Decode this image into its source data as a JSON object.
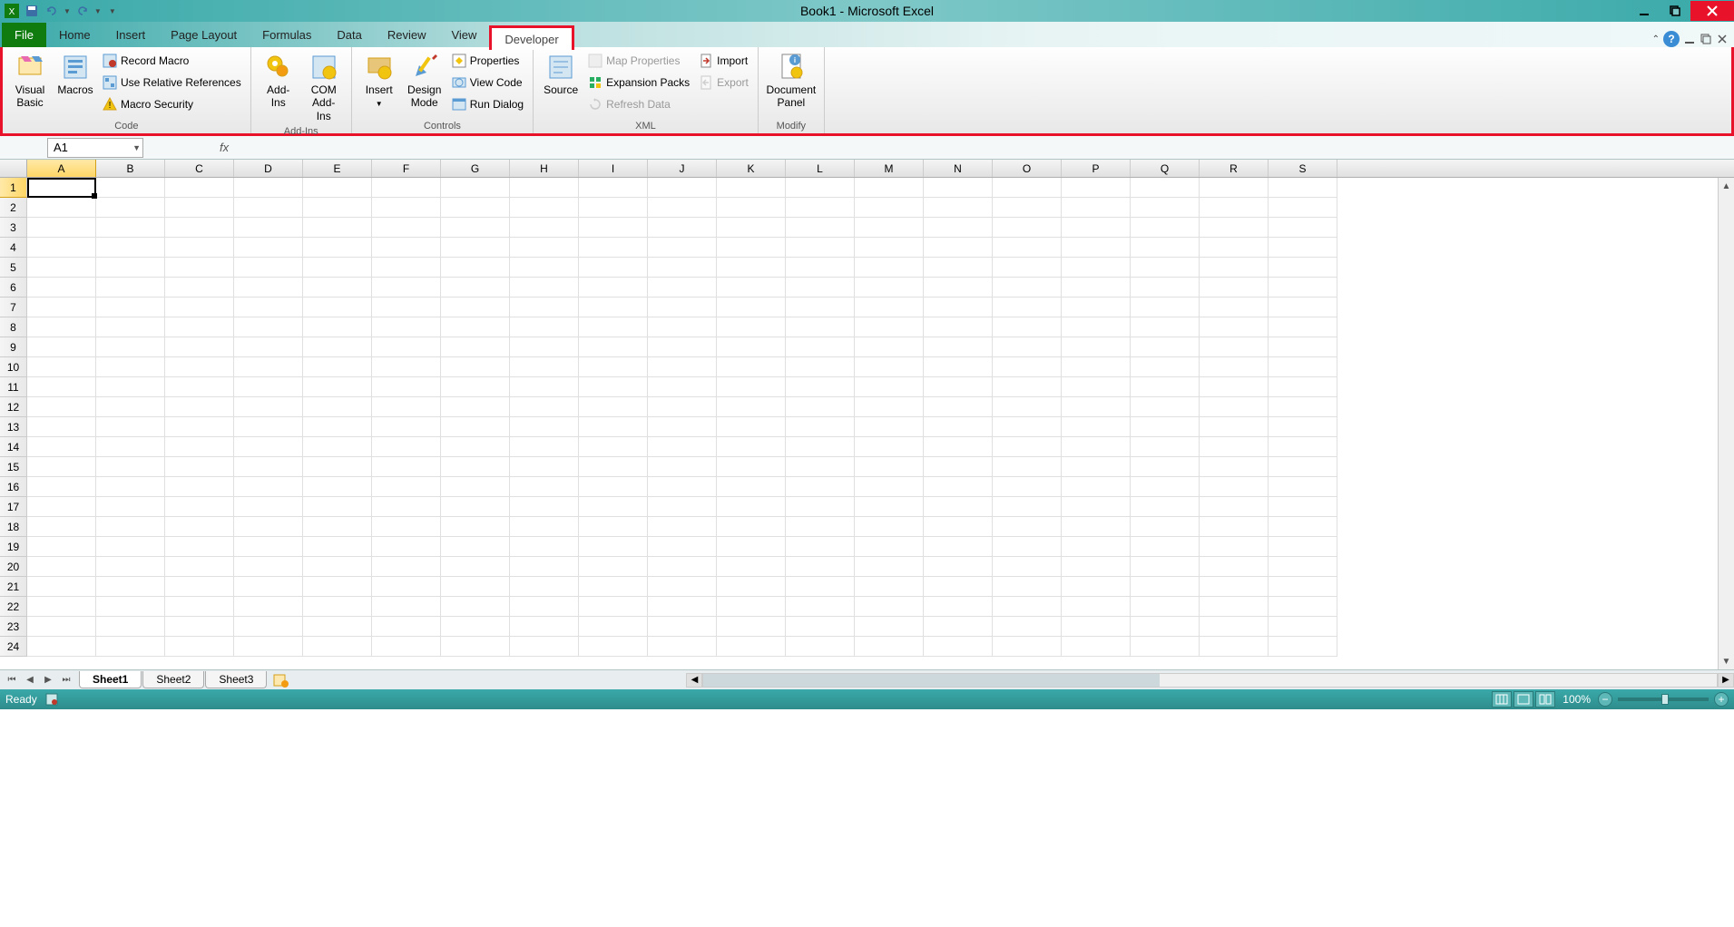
{
  "title": "Book1 - Microsoft Excel",
  "qat": {
    "save": "save",
    "undo": "undo",
    "redo": "redo"
  },
  "tabs": {
    "file": "File",
    "items": [
      "Home",
      "Insert",
      "Page Layout",
      "Formulas",
      "Data",
      "Review",
      "View",
      "Developer"
    ],
    "active": "Developer"
  },
  "ribbon": {
    "code": {
      "label": "Code",
      "visual_basic": "Visual\nBasic",
      "macros": "Macros",
      "record_macro": "Record Macro",
      "use_relative": "Use Relative References",
      "macro_security": "Macro Security"
    },
    "addins": {
      "label": "Add-Ins",
      "addins": "Add-Ins",
      "com_addins": "COM\nAdd-Ins"
    },
    "controls": {
      "label": "Controls",
      "insert": "Insert",
      "design_mode": "Design\nMode",
      "properties": "Properties",
      "view_code": "View Code",
      "run_dialog": "Run Dialog"
    },
    "xml": {
      "label": "XML",
      "source": "Source",
      "map_properties": "Map Properties",
      "expansion_packs": "Expansion Packs",
      "refresh_data": "Refresh Data",
      "import": "Import",
      "export": "Export"
    },
    "modify": {
      "label": "Modify",
      "document_panel": "Document\nPanel"
    }
  },
  "formula_bar": {
    "name_box": "A1",
    "fx": "fx",
    "formula": ""
  },
  "grid": {
    "columns": [
      "A",
      "B",
      "C",
      "D",
      "E",
      "F",
      "G",
      "H",
      "I",
      "J",
      "K",
      "L",
      "M",
      "N",
      "O",
      "P",
      "Q",
      "R",
      "S"
    ],
    "rows": [
      "1",
      "2",
      "3",
      "4",
      "5",
      "6",
      "7",
      "8",
      "9",
      "10",
      "11",
      "12",
      "13",
      "14",
      "15",
      "16",
      "17",
      "18",
      "19",
      "20",
      "21",
      "22",
      "23",
      "24"
    ],
    "active_col": "A",
    "active_row": "1"
  },
  "sheets": {
    "tabs": [
      "Sheet1",
      "Sheet2",
      "Sheet3"
    ],
    "active": "Sheet1"
  },
  "status": {
    "ready": "Ready",
    "zoom": "100%"
  }
}
